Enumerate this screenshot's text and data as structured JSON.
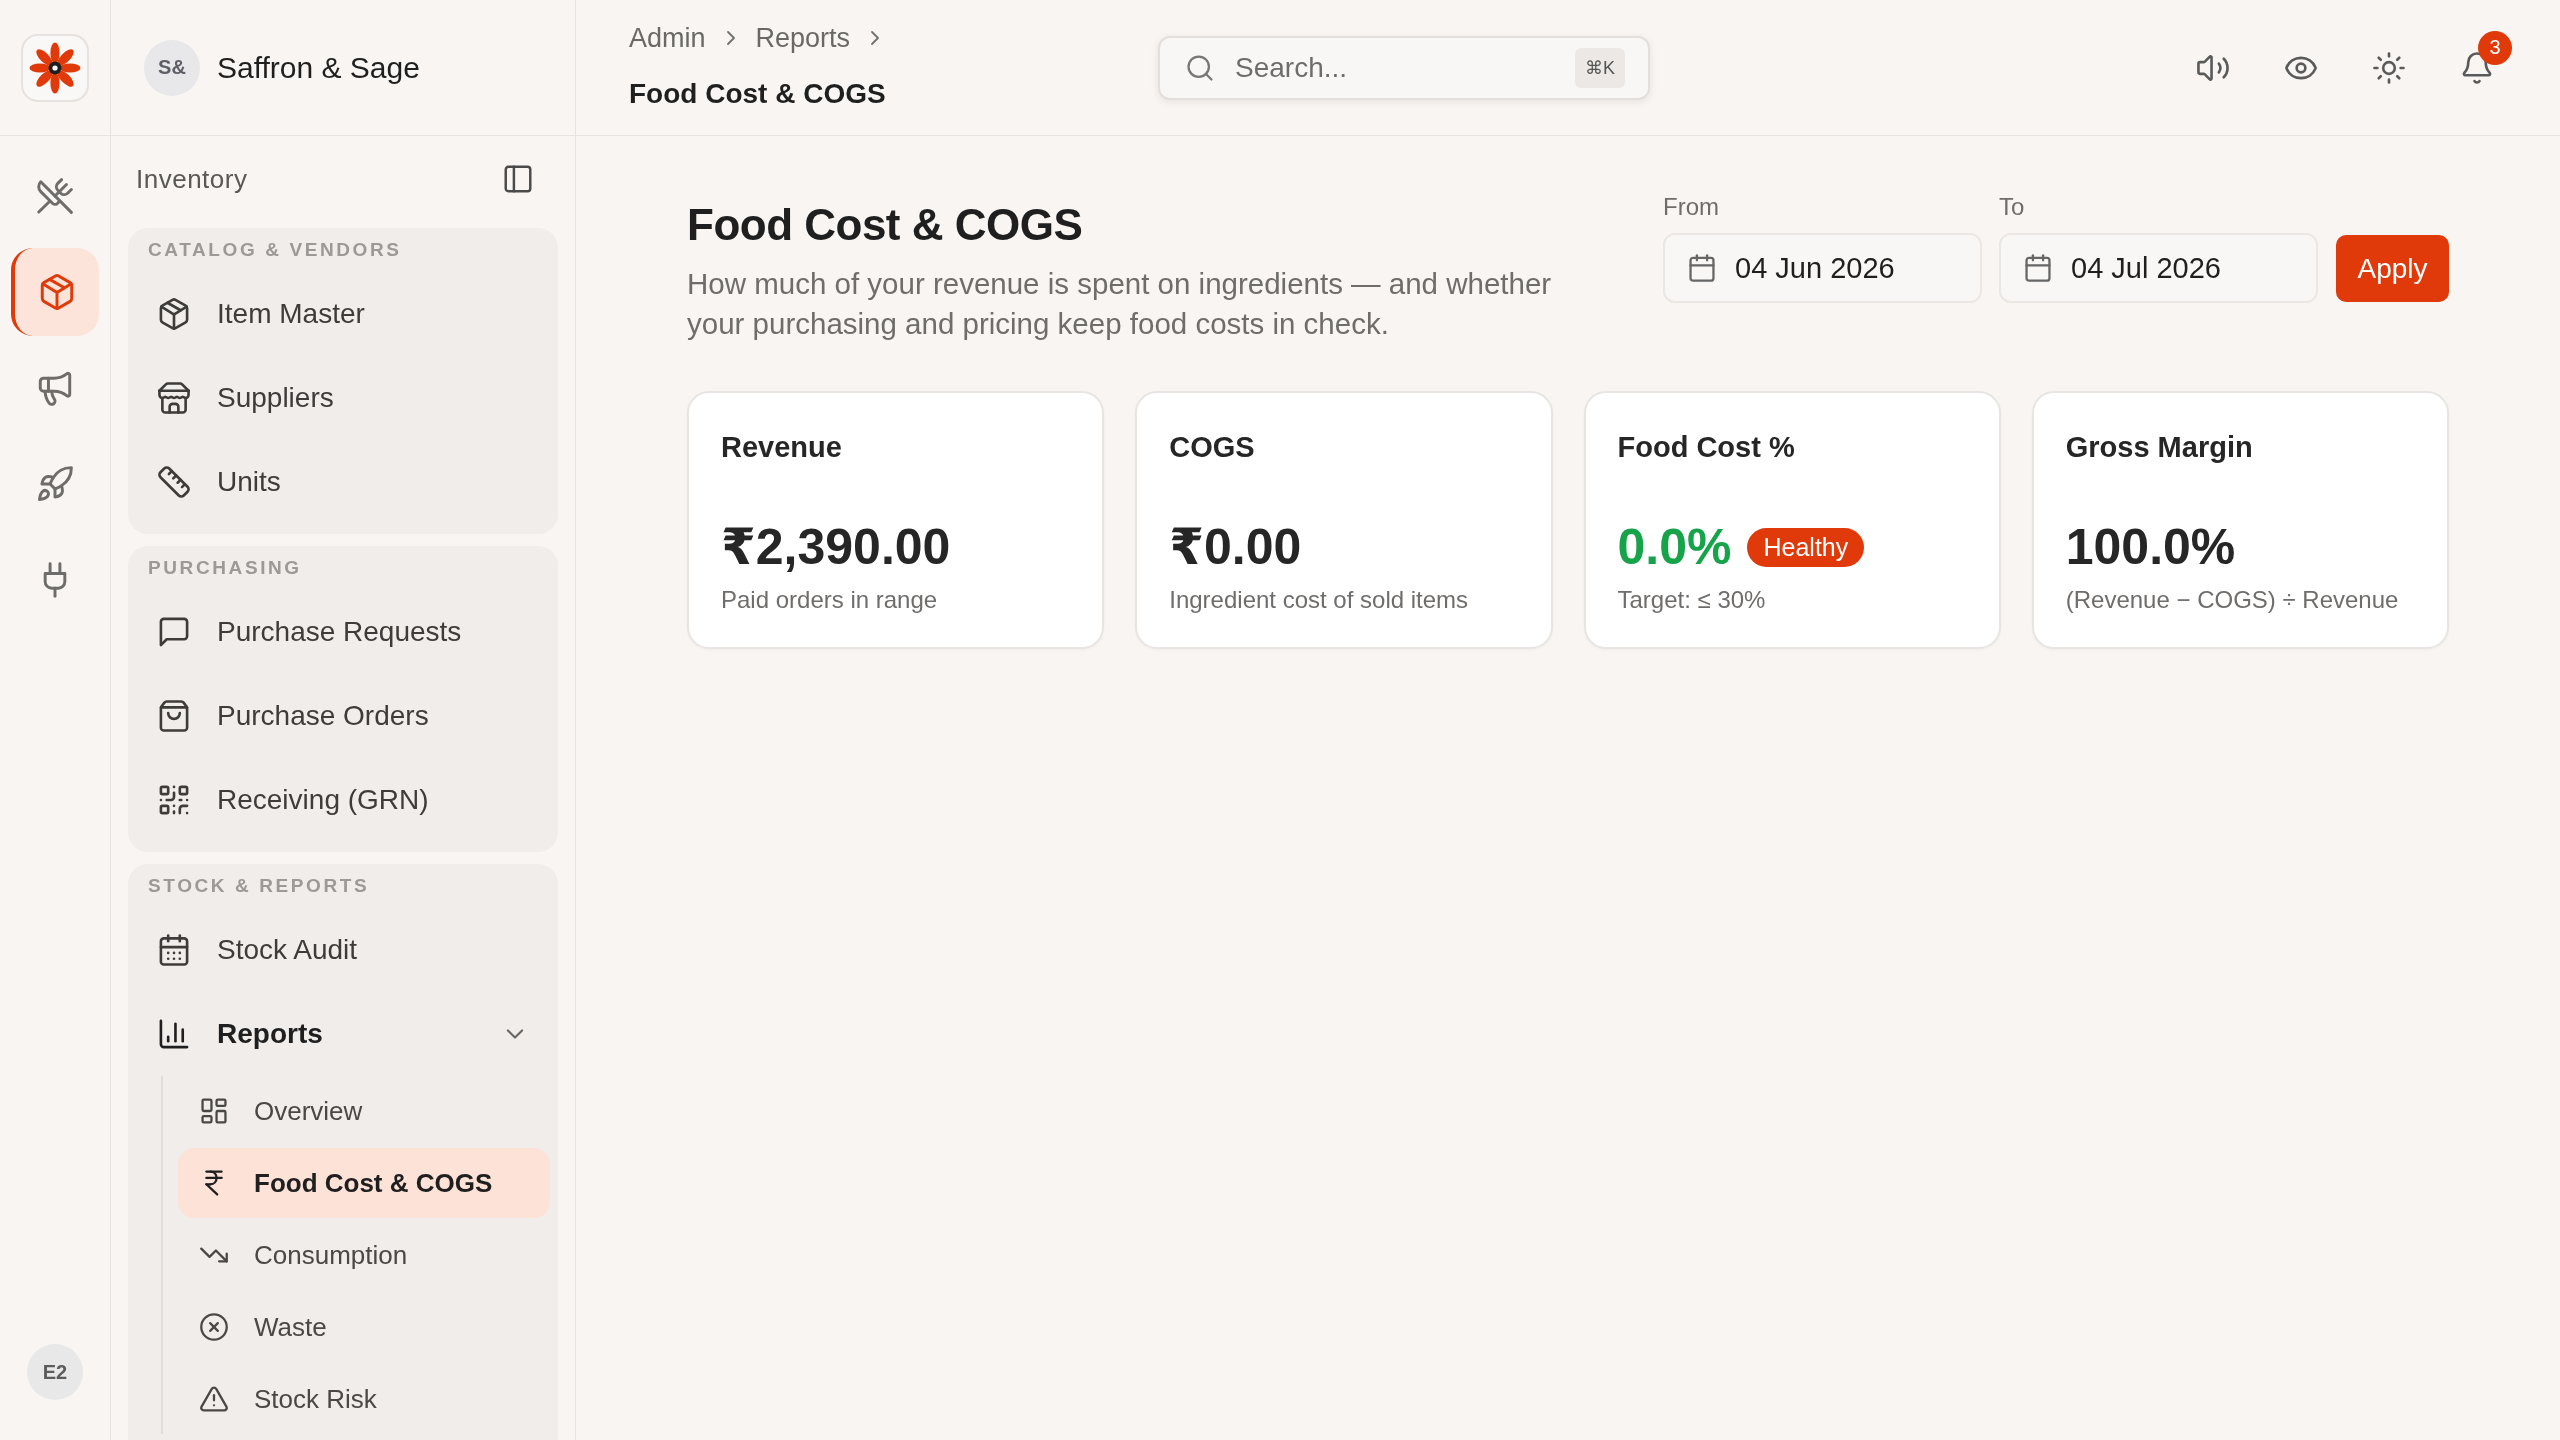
{
  "rail": {
    "items": [
      {
        "selected": false
      },
      {
        "selected": true
      },
      {
        "selected": false
      },
      {
        "selected": false
      },
      {
        "selected": false
      }
    ],
    "user_avatar": "E2"
  },
  "workspace": {
    "avatar": "S&",
    "name": "Saffron & Sage"
  },
  "sidebar": {
    "title": "Inventory",
    "groups": [
      {
        "title": "CATALOG & VENDORS",
        "items": [
          {
            "label": "Item Master",
            "selected": false
          },
          {
            "label": "Suppliers",
            "selected": false
          },
          {
            "label": "Units",
            "selected": false
          }
        ]
      },
      {
        "title": "PURCHASING",
        "items": [
          {
            "label": "Purchase Requests",
            "selected": false
          },
          {
            "label": "Purchase Orders",
            "selected": false
          },
          {
            "label": "Receiving (GRN)",
            "selected": false
          }
        ]
      },
      {
        "title": "STOCK & REPORTS",
        "items": [
          {
            "label": "Stock Audit",
            "selected": false
          },
          {
            "label": "Reports",
            "selected": false,
            "expanded": true,
            "children": [
              {
                "label": "Overview",
                "selected": false
              },
              {
                "label": "Food Cost & COGS",
                "selected": true
              },
              {
                "label": "Consumption",
                "selected": false
              },
              {
                "label": "Waste",
                "selected": false
              },
              {
                "label": "Stock Risk",
                "selected": false
              }
            ]
          }
        ]
      }
    ]
  },
  "topbar": {
    "breadcrumb": [
      "Admin",
      "Reports"
    ],
    "page_title": "Food Cost & COGS",
    "search": {
      "placeholder": "Search...",
      "shortcut": "⌘K"
    },
    "notifications": {
      "count": "3"
    }
  },
  "page": {
    "title": "Food Cost & COGS",
    "subtitle": "How much of your revenue is spent on ingredients — and whether your purchasing and pricing keep food costs in check.",
    "date_range": {
      "from": {
        "label": "From",
        "value": "04 Jun 2026"
      },
      "to": {
        "label": "To",
        "value": "04 Jul 2026"
      },
      "apply_button": "Apply"
    }
  },
  "kpis": [
    {
      "title": "Revenue",
      "value": "₹2,390.00",
      "caption": "Paid orders in range"
    },
    {
      "title": "COGS",
      "value": "₹0.00",
      "caption": "Ingredient cost of sold items"
    },
    {
      "title": "Food Cost %",
      "value": "0.0%",
      "color": "#16a34a",
      "badge": "Healthy",
      "caption": "Target: ≤ 30%"
    },
    {
      "title": "Gross Margin",
      "value": "100.0%",
      "caption": "(Revenue − COGS) ÷ Revenue"
    }
  ]
}
